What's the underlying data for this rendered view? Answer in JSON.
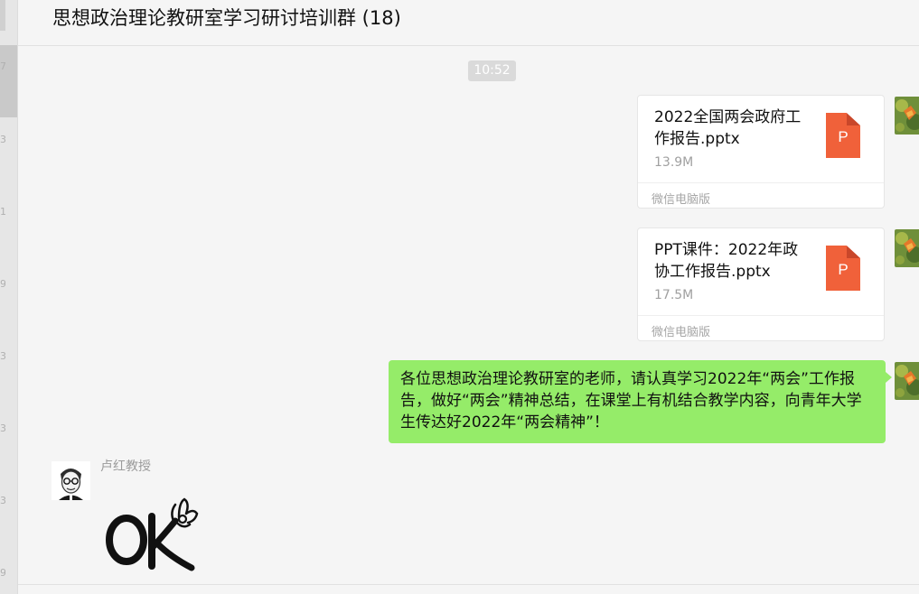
{
  "chat": {
    "title": "思想政治理论教研室学习研讨培训群 (18)"
  },
  "sidebar_digits": [
    "7",
    "3",
    "1",
    "9",
    "3",
    "3",
    "3",
    "9"
  ],
  "messages": {
    "time_divider": "10:52",
    "file1": {
      "name": "2022全国两会政府工作报告.pptx",
      "size": "13.9M",
      "source": "微信电脑版",
      "icon_letter": "P"
    },
    "file2": {
      "name": "PPT课件：2022年政协工作报告.pptx",
      "size": "17.5M",
      "source": "微信电脑版",
      "icon_letter": "P"
    },
    "text1": "各位思想政治理论教研室的老师，请认真学习2022年“两会”工作报告，做好“两会”精神总结，在课堂上有机结合教学内容，向青年大学生传达好2022年“两会精神”！",
    "sender": "卢红教授"
  },
  "colors": {
    "bubble_green": "#95ec69",
    "ppt_orange": "#f0613a",
    "background": "#f5f5f5"
  },
  "icons": {
    "file_type": "ppt-file-icon",
    "sticker": "ok-hand-sticker"
  }
}
